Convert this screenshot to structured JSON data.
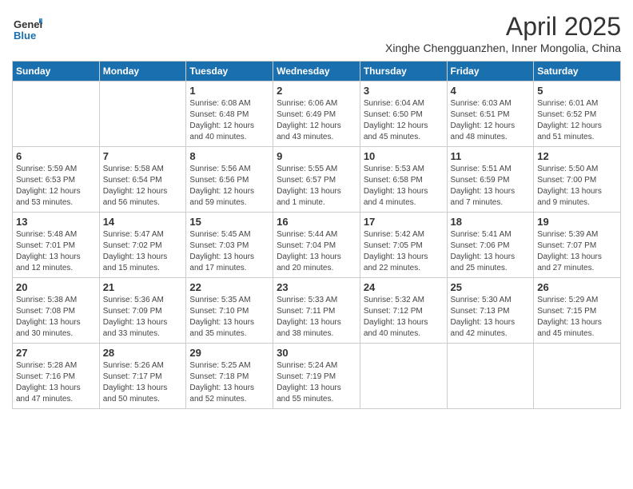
{
  "logo": {
    "text_general": "General",
    "text_blue": "Blue"
  },
  "title": "April 2025",
  "location": "Xinghe Chengguanzhen, Inner Mongolia, China",
  "days_of_week": [
    "Sunday",
    "Monday",
    "Tuesday",
    "Wednesday",
    "Thursday",
    "Friday",
    "Saturday"
  ],
  "weeks": [
    [
      {
        "day": "",
        "sunrise": "",
        "sunset": "",
        "daylight": "",
        "empty": true
      },
      {
        "day": "",
        "sunrise": "",
        "sunset": "",
        "daylight": "",
        "empty": true
      },
      {
        "day": "1",
        "sunrise": "Sunrise: 6:08 AM",
        "sunset": "Sunset: 6:48 PM",
        "daylight": "Daylight: 12 hours and 40 minutes.",
        "empty": false
      },
      {
        "day": "2",
        "sunrise": "Sunrise: 6:06 AM",
        "sunset": "Sunset: 6:49 PM",
        "daylight": "Daylight: 12 hours and 43 minutes.",
        "empty": false
      },
      {
        "day": "3",
        "sunrise": "Sunrise: 6:04 AM",
        "sunset": "Sunset: 6:50 PM",
        "daylight": "Daylight: 12 hours and 45 minutes.",
        "empty": false
      },
      {
        "day": "4",
        "sunrise": "Sunrise: 6:03 AM",
        "sunset": "Sunset: 6:51 PM",
        "daylight": "Daylight: 12 hours and 48 minutes.",
        "empty": false
      },
      {
        "day": "5",
        "sunrise": "Sunrise: 6:01 AM",
        "sunset": "Sunset: 6:52 PM",
        "daylight": "Daylight: 12 hours and 51 minutes.",
        "empty": false
      }
    ],
    [
      {
        "day": "6",
        "sunrise": "Sunrise: 5:59 AM",
        "sunset": "Sunset: 6:53 PM",
        "daylight": "Daylight: 12 hours and 53 minutes.",
        "empty": false
      },
      {
        "day": "7",
        "sunrise": "Sunrise: 5:58 AM",
        "sunset": "Sunset: 6:54 PM",
        "daylight": "Daylight: 12 hours and 56 minutes.",
        "empty": false
      },
      {
        "day": "8",
        "sunrise": "Sunrise: 5:56 AM",
        "sunset": "Sunset: 6:56 PM",
        "daylight": "Daylight: 12 hours and 59 minutes.",
        "empty": false
      },
      {
        "day": "9",
        "sunrise": "Sunrise: 5:55 AM",
        "sunset": "Sunset: 6:57 PM",
        "daylight": "Daylight: 13 hours and 1 minute.",
        "empty": false
      },
      {
        "day": "10",
        "sunrise": "Sunrise: 5:53 AM",
        "sunset": "Sunset: 6:58 PM",
        "daylight": "Daylight: 13 hours and 4 minutes.",
        "empty": false
      },
      {
        "day": "11",
        "sunrise": "Sunrise: 5:51 AM",
        "sunset": "Sunset: 6:59 PM",
        "daylight": "Daylight: 13 hours and 7 minutes.",
        "empty": false
      },
      {
        "day": "12",
        "sunrise": "Sunrise: 5:50 AM",
        "sunset": "Sunset: 7:00 PM",
        "daylight": "Daylight: 13 hours and 9 minutes.",
        "empty": false
      }
    ],
    [
      {
        "day": "13",
        "sunrise": "Sunrise: 5:48 AM",
        "sunset": "Sunset: 7:01 PM",
        "daylight": "Daylight: 13 hours and 12 minutes.",
        "empty": false
      },
      {
        "day": "14",
        "sunrise": "Sunrise: 5:47 AM",
        "sunset": "Sunset: 7:02 PM",
        "daylight": "Daylight: 13 hours and 15 minutes.",
        "empty": false
      },
      {
        "day": "15",
        "sunrise": "Sunrise: 5:45 AM",
        "sunset": "Sunset: 7:03 PM",
        "daylight": "Daylight: 13 hours and 17 minutes.",
        "empty": false
      },
      {
        "day": "16",
        "sunrise": "Sunrise: 5:44 AM",
        "sunset": "Sunset: 7:04 PM",
        "daylight": "Daylight: 13 hours and 20 minutes.",
        "empty": false
      },
      {
        "day": "17",
        "sunrise": "Sunrise: 5:42 AM",
        "sunset": "Sunset: 7:05 PM",
        "daylight": "Daylight: 13 hours and 22 minutes.",
        "empty": false
      },
      {
        "day": "18",
        "sunrise": "Sunrise: 5:41 AM",
        "sunset": "Sunset: 7:06 PM",
        "daylight": "Daylight: 13 hours and 25 minutes.",
        "empty": false
      },
      {
        "day": "19",
        "sunrise": "Sunrise: 5:39 AM",
        "sunset": "Sunset: 7:07 PM",
        "daylight": "Daylight: 13 hours and 27 minutes.",
        "empty": false
      }
    ],
    [
      {
        "day": "20",
        "sunrise": "Sunrise: 5:38 AM",
        "sunset": "Sunset: 7:08 PM",
        "daylight": "Daylight: 13 hours and 30 minutes.",
        "empty": false
      },
      {
        "day": "21",
        "sunrise": "Sunrise: 5:36 AM",
        "sunset": "Sunset: 7:09 PM",
        "daylight": "Daylight: 13 hours and 33 minutes.",
        "empty": false
      },
      {
        "day": "22",
        "sunrise": "Sunrise: 5:35 AM",
        "sunset": "Sunset: 7:10 PM",
        "daylight": "Daylight: 13 hours and 35 minutes.",
        "empty": false
      },
      {
        "day": "23",
        "sunrise": "Sunrise: 5:33 AM",
        "sunset": "Sunset: 7:11 PM",
        "daylight": "Daylight: 13 hours and 38 minutes.",
        "empty": false
      },
      {
        "day": "24",
        "sunrise": "Sunrise: 5:32 AM",
        "sunset": "Sunset: 7:12 PM",
        "daylight": "Daylight: 13 hours and 40 minutes.",
        "empty": false
      },
      {
        "day": "25",
        "sunrise": "Sunrise: 5:30 AM",
        "sunset": "Sunset: 7:13 PM",
        "daylight": "Daylight: 13 hours and 42 minutes.",
        "empty": false
      },
      {
        "day": "26",
        "sunrise": "Sunrise: 5:29 AM",
        "sunset": "Sunset: 7:15 PM",
        "daylight": "Daylight: 13 hours and 45 minutes.",
        "empty": false
      }
    ],
    [
      {
        "day": "27",
        "sunrise": "Sunrise: 5:28 AM",
        "sunset": "Sunset: 7:16 PM",
        "daylight": "Daylight: 13 hours and 47 minutes.",
        "empty": false
      },
      {
        "day": "28",
        "sunrise": "Sunrise: 5:26 AM",
        "sunset": "Sunset: 7:17 PM",
        "daylight": "Daylight: 13 hours and 50 minutes.",
        "empty": false
      },
      {
        "day": "29",
        "sunrise": "Sunrise: 5:25 AM",
        "sunset": "Sunset: 7:18 PM",
        "daylight": "Daylight: 13 hours and 52 minutes.",
        "empty": false
      },
      {
        "day": "30",
        "sunrise": "Sunrise: 5:24 AM",
        "sunset": "Sunset: 7:19 PM",
        "daylight": "Daylight: 13 hours and 55 minutes.",
        "empty": false
      },
      {
        "day": "",
        "sunrise": "",
        "sunset": "",
        "daylight": "",
        "empty": true
      },
      {
        "day": "",
        "sunrise": "",
        "sunset": "",
        "daylight": "",
        "empty": true
      },
      {
        "day": "",
        "sunrise": "",
        "sunset": "",
        "daylight": "",
        "empty": true
      }
    ]
  ]
}
